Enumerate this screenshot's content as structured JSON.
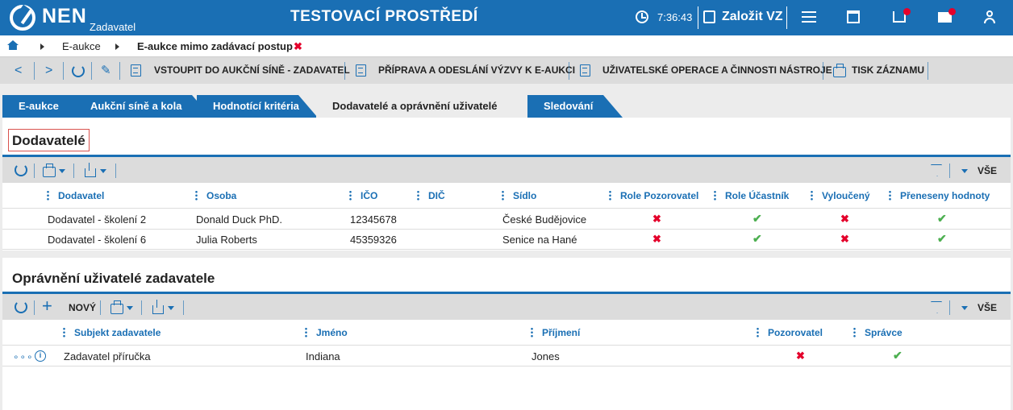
{
  "header": {
    "logo_text": "NEN",
    "logo_sub": "Zadavatel",
    "environment": "TESTOVACÍ PROSTŘEDÍ",
    "time": "7:36:43",
    "create_label": "Založit VZ"
  },
  "breadcrumb": {
    "items": [
      "E-aukce",
      "E-aukce mimo zadávací postup"
    ],
    "close": "✖"
  },
  "actions": {
    "enter_auction": "VSTOUPIT DO AUKČNÍ SÍNĚ - ZADAVATEL",
    "prepare_call": "PŘÍPRAVA A ODESLÁNÍ VÝZVY K E-AUKCI",
    "user_ops": "UŽIVATELSKÉ OPERACE A ČINNOSTI NÁSTROJE",
    "print_record": "TISK ZÁZNAMU"
  },
  "tabs": [
    "E-aukce",
    "Aukční síně a kola",
    "Hodnotící kritéria",
    "Dodavatelé a oprávnění uživatelé",
    "Sledování"
  ],
  "suppliers": {
    "title": "Dodavatelé",
    "all_label": "VŠE",
    "columns": [
      "Dodavatel",
      "Osoba",
      "IČO",
      "DIČ",
      "Sídlo",
      "Role Pozorovatel",
      "Role Účastník",
      "Vyloučený",
      "Přeneseny hodnoty"
    ],
    "rows": [
      {
        "dodavatel": "Dodavatel - školení 2",
        "osoba": "Donald Duck PhD.",
        "ico": "12345678",
        "dic": "",
        "sidlo": "České Budějovice",
        "pozorovatel": false,
        "ucastnik": true,
        "vylouceny": false,
        "preneseny": true
      },
      {
        "dodavatel": "Dodavatel - školení 6",
        "osoba": "Julia Roberts",
        "ico": "45359326",
        "dic": "",
        "sidlo": "Senice na Hané",
        "pozorovatel": false,
        "ucastnik": true,
        "vylouceny": false,
        "preneseny": true
      }
    ]
  },
  "users": {
    "title": "Oprávnění uživatelé zadavatele",
    "new_label": "NOVÝ",
    "all_label": "VŠE",
    "columns": [
      "Subjekt zadavatele",
      "Jméno",
      "Příjmení",
      "Pozorovatel",
      "Správce"
    ],
    "rows": [
      {
        "subjekt": "Zadavatel příručka",
        "jmeno": "Indiana",
        "prijmeni": "Jones",
        "pozorovatel": false,
        "spravce": true
      }
    ]
  },
  "symbols": {
    "check": "✔",
    "cross": "✖",
    "info": "i",
    "more": "∘∘∘"
  },
  "colors": {
    "brand": "#1a6fb4",
    "red": "#e4002b",
    "green": "#4caf50"
  },
  "icons": [
    "home-icon",
    "clock-icon",
    "create-icon",
    "menu-icon",
    "calendar-icon",
    "inbox-icon",
    "mail-icon",
    "user-icon",
    "refresh-icon",
    "print-icon",
    "export-icon",
    "filter-icon",
    "info-icon"
  ]
}
